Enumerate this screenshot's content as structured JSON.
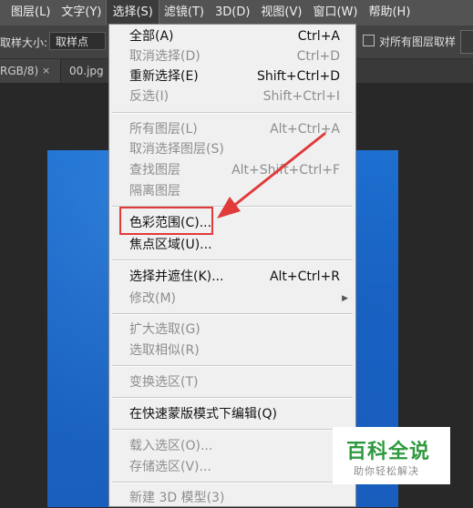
{
  "menubar": {
    "items": [
      "图层(L)",
      "文字(Y)",
      "选择(S)",
      "滤镜(T)",
      "3D(D)",
      "视图(V)",
      "窗口(W)",
      "帮助(H)"
    ],
    "active_index": 2
  },
  "options": {
    "sample_size_label": "取样大小:",
    "sample_size_value": "取样点",
    "all_layers_label": "对所有图层取样"
  },
  "tabs": {
    "tab1": "RGB/8)",
    "tab1_close": "×",
    "tab2": "00.jpg @"
  },
  "menu": {
    "all": {
      "label": "全部(A)",
      "shortcut": "Ctrl+A"
    },
    "deselect": {
      "label": "取消选择(D)",
      "shortcut": "Ctrl+D"
    },
    "reselect": {
      "label": "重新选择(E)",
      "shortcut": "Shift+Ctrl+D"
    },
    "inverse": {
      "label": "反选(I)",
      "shortcut": "Shift+Ctrl+I"
    },
    "all_layers": {
      "label": "所有图层(L)",
      "shortcut": "Alt+Ctrl+A"
    },
    "deselect_layers": {
      "label": "取消选择图层(S)"
    },
    "find_layers": {
      "label": "查找图层",
      "shortcut": "Alt+Shift+Ctrl+F"
    },
    "isolate_layers": {
      "label": "隔离图层"
    },
    "color_range": {
      "label": "色彩范围(C)..."
    },
    "focus_area": {
      "label": "焦点区域(U)..."
    },
    "select_mask": {
      "label": "选择并遮住(K)...",
      "shortcut": "Alt+Ctrl+R"
    },
    "modify": {
      "label": "修改(M)"
    },
    "grow": {
      "label": "扩大选取(G)"
    },
    "similar": {
      "label": "选取相似(R)"
    },
    "transform": {
      "label": "变换选区(T)"
    },
    "quick_mask": {
      "label": "在快速蒙版模式下编辑(Q)"
    },
    "load": {
      "label": "载入选区(O)..."
    },
    "save": {
      "label": "存储选区(V)..."
    },
    "new_3d": {
      "label": "新建 3D 模型(3)"
    }
  },
  "watermark": {
    "title": "百科全说",
    "subtitle": "助你轻松解决"
  },
  "colors": {
    "annotation": "#e03a3a",
    "canvas_blue": "#1a64c4",
    "watermark_green": "#2e9a3e"
  }
}
